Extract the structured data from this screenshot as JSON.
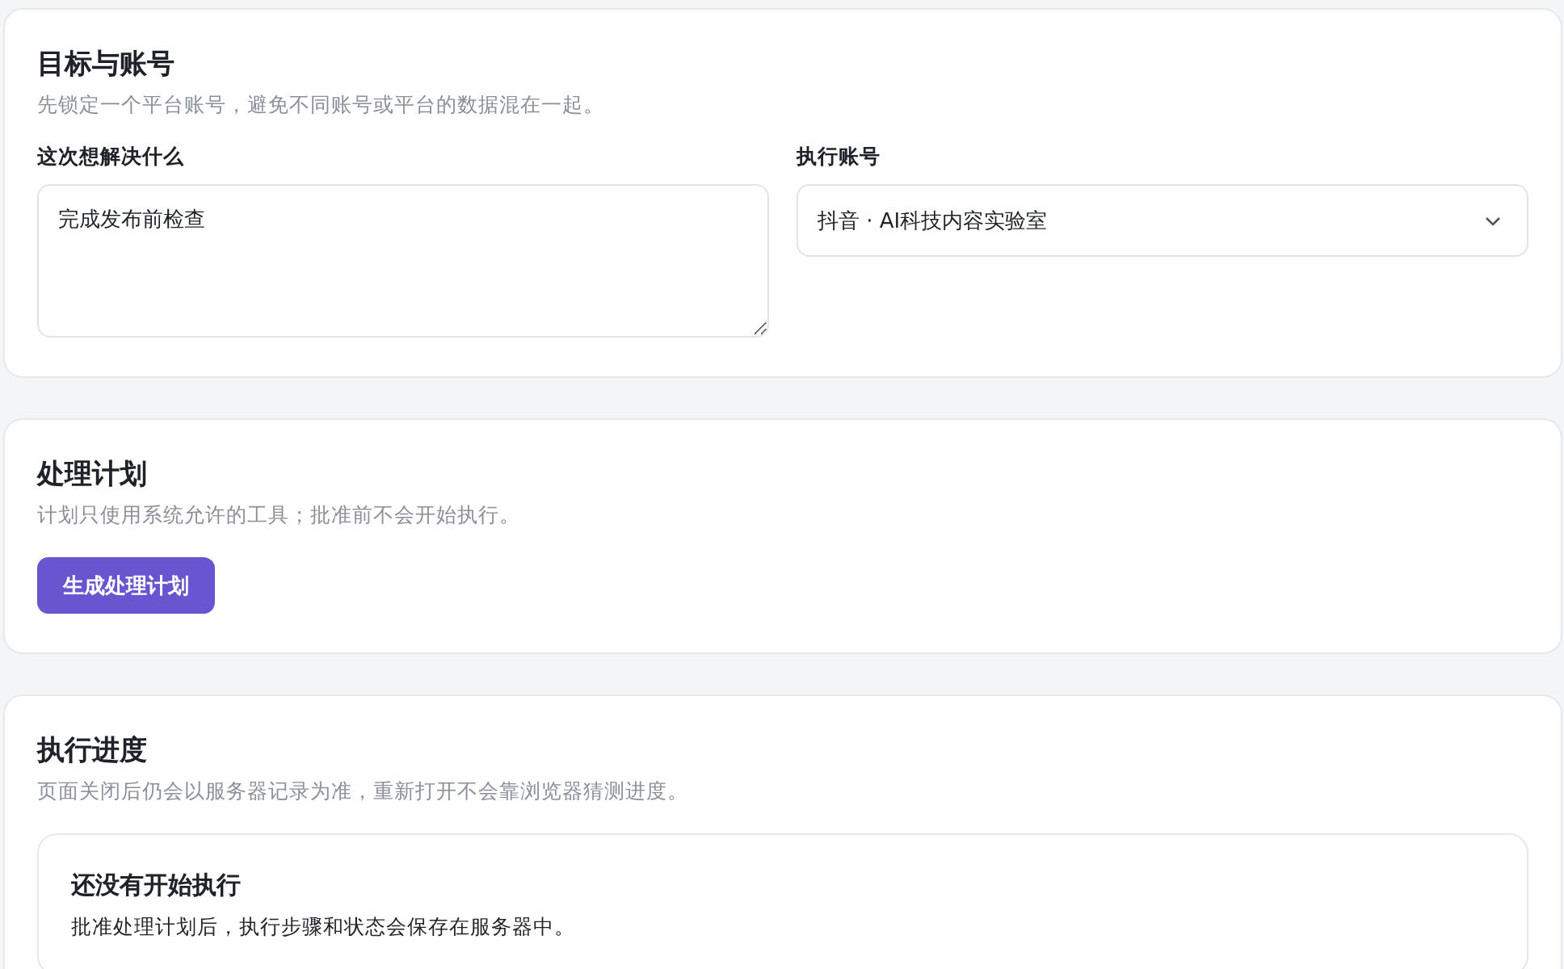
{
  "goal_section": {
    "title": "目标与账号",
    "description": "先锁定一个平台账号，避免不同账号或平台的数据混在一起。",
    "goal_field": {
      "label": "这次想解决什么",
      "value": "完成发布前检查"
    },
    "account_field": {
      "label": "执行账号",
      "value": "抖音 · AI科技内容实验室"
    }
  },
  "plan_section": {
    "title": "处理计划",
    "description": "计划只使用系统允许的工具；批准前不会开始执行。",
    "button": "生成处理计划"
  },
  "progress_section": {
    "title": "执行进度",
    "description": "页面关闭后仍会以服务器记录为准，重新打开不会靠浏览器猜测进度。",
    "empty_state": {
      "title": "还没有开始执行",
      "description": "批准处理计划后，执行步骤和状态会保存在服务器中。"
    }
  }
}
